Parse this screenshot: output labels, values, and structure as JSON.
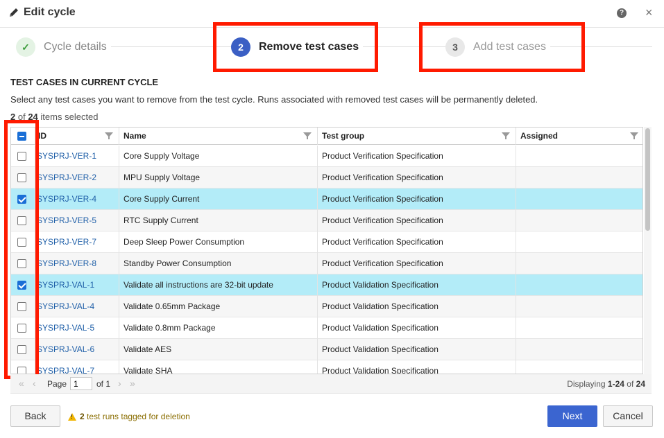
{
  "dialog": {
    "title": "Edit cycle",
    "help_icon": "help-icon",
    "close_icon": "close-icon"
  },
  "steps": [
    {
      "number": "✓",
      "label": "Cycle details",
      "state": "done"
    },
    {
      "number": "2",
      "label": "Remove test cases",
      "state": "active"
    },
    {
      "number": "3",
      "label": "Add test cases",
      "state": "todo"
    }
  ],
  "section": {
    "title": "TEST CASES IN CURRENT CYCLE",
    "description": "Select any test cases you want to remove from the test cycle. Runs associated with removed test cases will be permanently deleted.",
    "selected_count": "2",
    "of_label": "of",
    "total_count": "24",
    "items_selected_label": "items selected"
  },
  "table": {
    "columns": [
      "ID",
      "Name",
      "Test group",
      "Assigned"
    ],
    "rows": [
      {
        "id": "SYSPRJ-VER-1",
        "name": "Core Supply Voltage",
        "group": "Product Verification Specification",
        "assigned": "",
        "checked": false
      },
      {
        "id": "SYSPRJ-VER-2",
        "name": "MPU Supply Voltage",
        "group": "Product Verification Specification",
        "assigned": "",
        "checked": false
      },
      {
        "id": "SYSPRJ-VER-4",
        "name": "Core Supply Current",
        "group": "Product Verification Specification",
        "assigned": "",
        "checked": true
      },
      {
        "id": "SYSPRJ-VER-5",
        "name": "RTC Supply Current",
        "group": "Product Verification Specification",
        "assigned": "",
        "checked": false
      },
      {
        "id": "SYSPRJ-VER-7",
        "name": "Deep Sleep Power Consumption",
        "group": "Product Verification Specification",
        "assigned": "",
        "checked": false
      },
      {
        "id": "SYSPRJ-VER-8",
        "name": "Standby Power Consumption",
        "group": "Product Verification Specification",
        "assigned": "",
        "checked": false
      },
      {
        "id": "SYSPRJ-VAL-1",
        "name": "Validate all instructions are 32-bit update",
        "group": "Product Validation Specification",
        "assigned": "",
        "checked": true
      },
      {
        "id": "SYSPRJ-VAL-4",
        "name": "Validate 0.65mm Package",
        "group": "Product Validation Specification",
        "assigned": "",
        "checked": false
      },
      {
        "id": "SYSPRJ-VAL-5",
        "name": "Validate 0.8mm Package",
        "group": "Product Validation Specification",
        "assigned": "",
        "checked": false
      },
      {
        "id": "SYSPRJ-VAL-6",
        "name": "Validate AES",
        "group": "Product Validation Specification",
        "assigned": "",
        "checked": false
      },
      {
        "id": "SYSPRJ-VAL-7",
        "name": "Validate SHA",
        "group": "Product Validation Specification",
        "assigned": "",
        "checked": false
      }
    ]
  },
  "pager": {
    "page_label": "Page",
    "page_value": "1",
    "of_label": "of 1",
    "displaying_label": "Displaying",
    "range": "1-24",
    "of": "of",
    "total": "24"
  },
  "footer": {
    "back_label": "Back",
    "warning_count": "2",
    "warning_text": "test runs tagged for deletion",
    "next_label": "Next",
    "cancel_label": "Cancel"
  },
  "colors": {
    "highlight": "#ff1a00",
    "primary": "#3b65d0",
    "selected_row": "#b3ecf8",
    "link": "#1f5fa8"
  }
}
